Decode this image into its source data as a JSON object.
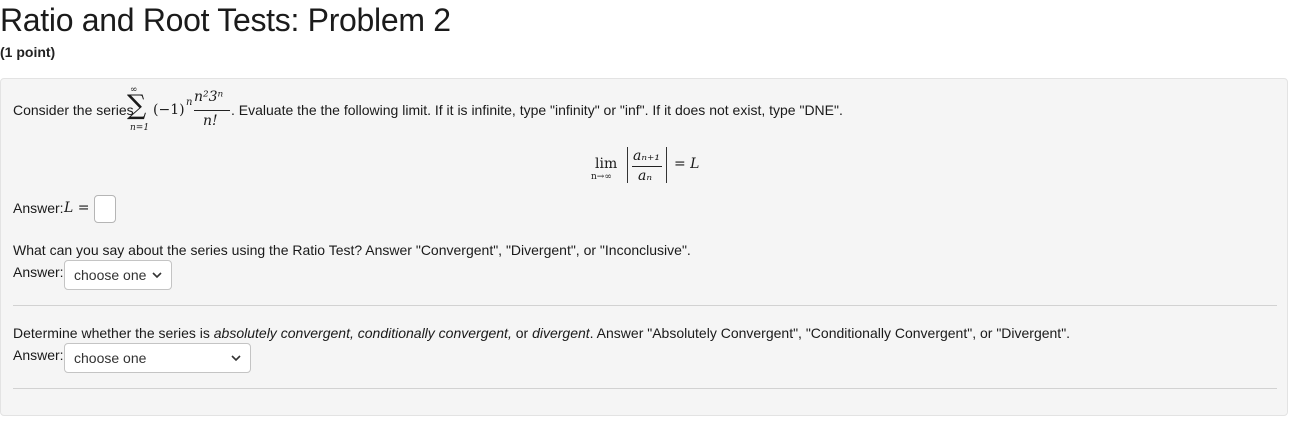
{
  "header": {
    "title": "Ratio and Root Tests: Problem 2",
    "points": "(1 point)"
  },
  "problem": {
    "intro_prefix": "Consider the series",
    "series": {
      "sum_upper": "∞",
      "sum_lower": "n=1",
      "factor": "(−1)",
      "factor_exp": "n",
      "numerator": "n²3ⁿ",
      "denominator": "n!"
    },
    "intro_suffix": ". Evaluate the the following limit. If it is infinite, type \"infinity\" or \"inf\". If it does not exist, type \"DNE\".",
    "limit": {
      "lim": "lim",
      "lim_sub": "n→∞",
      "numerator": "aₙ₊₁",
      "denominator": "aₙ",
      "rhs": "= L"
    },
    "answer1_label": "Answer:",
    "answer1_var": "L =",
    "answer1_value": "",
    "question2": "What can you say about the series using the Ratio Test? Answer \"Convergent\", \"Divergent\", or \"Inconclusive\".",
    "answer2_label": "Answer:",
    "answer2_select": "choose one",
    "question3_prefix": "Determine whether the series is ",
    "question3_em1": "absolutely convergent, conditionally convergent,",
    "question3_mid": " or ",
    "question3_em2": "divergent",
    "question3_suffix": ". Answer \"Absolutely Convergent\", \"Conditionally Convergent\", or \"Divergent\".",
    "answer3_label": "Answer:",
    "answer3_select": "choose one"
  }
}
